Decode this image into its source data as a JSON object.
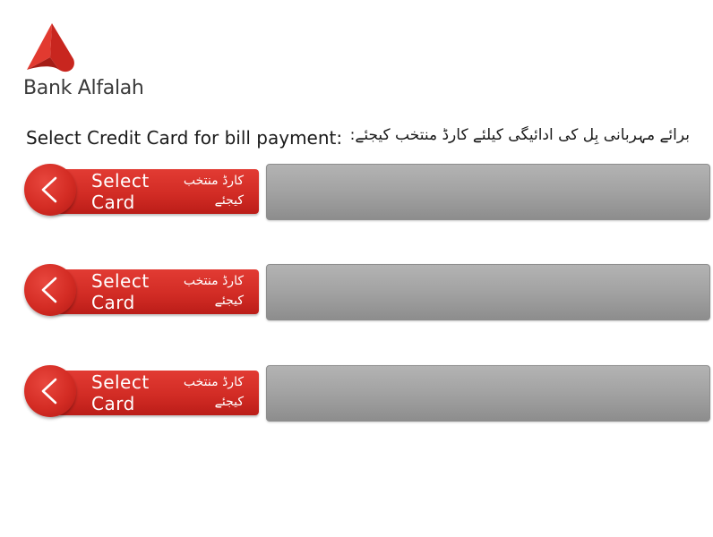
{
  "brand": {
    "name": "Bank Alfalah",
    "logo_icon": "alfalah-heart-logo",
    "color": "#d42c24"
  },
  "prompt": {
    "english": "Select Credit Card for bill payment:",
    "urdu": "برائے مہربانی بِل کی ادائیگی کیلئے کارڈ منتخب کیجئے:"
  },
  "card_rows": [
    {
      "button": {
        "label_en": "Select Card",
        "label_ur_line1": "کارڈ منتخب",
        "label_ur_line2": "کیجئے",
        "icon": "chevron-left-icon"
      },
      "card_text": ""
    },
    {
      "button": {
        "label_en": "Select Card",
        "label_ur_line1": "کارڈ منتخب",
        "label_ur_line2": "کیجئے",
        "icon": "chevron-left-icon"
      },
      "card_text": ""
    },
    {
      "button": {
        "label_en": "Select Card",
        "label_ur_line1": "کارڈ منتخب",
        "label_ur_line2": "کیجئے",
        "icon": "chevron-left-icon"
      },
      "card_text": ""
    }
  ],
  "colors": {
    "button_red": "#d42c24",
    "panel_gray": "#a2a2a2"
  }
}
